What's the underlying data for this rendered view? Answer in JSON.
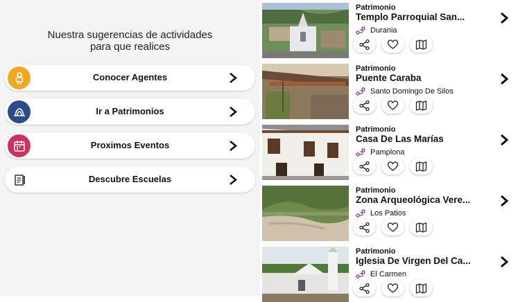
{
  "intro": {
    "line1": "Nuestra sugerencias de actividades",
    "line2": "para que realices"
  },
  "actions": [
    {
      "label": "Conocer Agentes",
      "icon": "agent-icon",
      "color": "#f2a81d"
    },
    {
      "label": "Ir a Patrimonios",
      "icon": "heritage-icon",
      "color": "#2b4c8c"
    },
    {
      "label": "Proximos Eventos",
      "icon": "calendar-icon",
      "color": "#d1305b"
    },
    {
      "label": "Descubre Escuelas",
      "icon": "school-icon",
      "color": "#ffffff"
    }
  ],
  "heritage": [
    {
      "category": "Patrimonio",
      "title": "Templo Parroquial San...",
      "location": "Durania"
    },
    {
      "category": "Patrimonio",
      "title": "Puente Caraba",
      "location": "Santo Domingo De Silos"
    },
    {
      "category": "Patrimonio",
      "title": "Casa De Las Marías",
      "location": "Pamplona"
    },
    {
      "category": "Patrimonio",
      "title": "Zona Arqueológica Vere...",
      "location": "Los Patios"
    },
    {
      "category": "Patrimonio",
      "title": "Iglesia De Virgen Del Ca...",
      "location": "El Carmen"
    }
  ],
  "colors": {
    "accent": "#8a3fa0",
    "topbar": "#1f3c88"
  }
}
